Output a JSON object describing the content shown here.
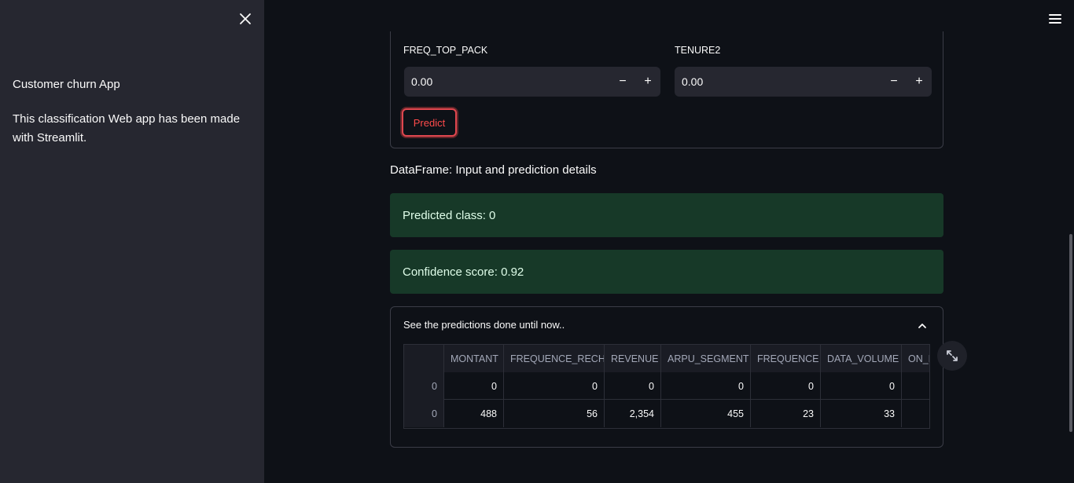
{
  "sidebar": {
    "title": "Customer churn App",
    "description": "This classification Web app has been made with Streamlit."
  },
  "form": {
    "fields": [
      {
        "label": "FREQ_TOP_PACK",
        "value": "0.00"
      },
      {
        "label": "TENURE2",
        "value": "0.00"
      }
    ],
    "stepper_minus": "−",
    "stepper_plus": "+",
    "predict_label": "Predict"
  },
  "dataframe_caption": "DataFrame: Input and prediction details",
  "alerts": {
    "predicted_class": "Predicted class: 0",
    "confidence": "Confidence score: 0.92"
  },
  "expander": {
    "title": "See the predictions done until now.."
  },
  "table": {
    "columns": [
      "",
      "MONTANT",
      "FREQUENCE_RECH",
      "REVENUE",
      "ARPU_SEGMENT",
      "FREQUENCE",
      "DATA_VOLUME",
      "ON_N"
    ],
    "rows": [
      [
        "0",
        "0",
        "0",
        "0",
        "0",
        "0",
        "0",
        ""
      ],
      [
        "0",
        "488",
        "56",
        "2,354",
        "455",
        "23",
        "33",
        ""
      ]
    ]
  },
  "colors": {
    "background": "#0e1117",
    "sidebar": "#262730",
    "accent": "#ff4b4b",
    "success_bg": "#173928"
  },
  "icons": {
    "close": "close-icon",
    "menu": "hamburger-menu-icon",
    "chevron": "chevron-up-icon",
    "fullscreen": "fullscreen-icon"
  }
}
